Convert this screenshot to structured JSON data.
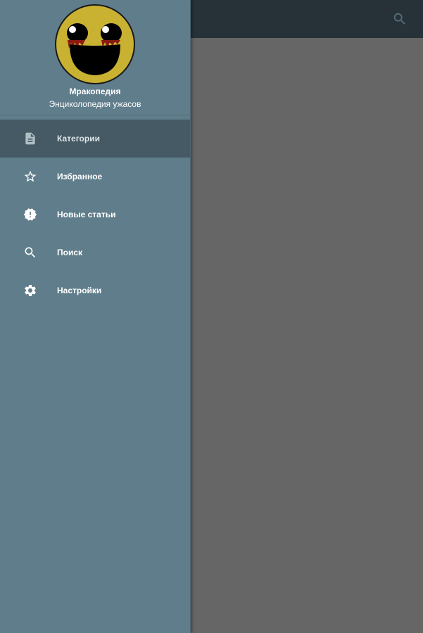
{
  "colors": {
    "appbar": "#263238",
    "drawer": "#607d8b",
    "drawer_active": "#455a64",
    "content_scrim": "#666666",
    "avatar_face": "#c9b132"
  },
  "header": {
    "app_name": "Мракопедия",
    "app_subtitle": "Энциколопедия ужасов",
    "avatar_icon": "creepy-smiley-logo"
  },
  "appbar": {
    "search_icon": "search-icon"
  },
  "menu": {
    "items": [
      {
        "label": "Категории",
        "icon": "document-icon",
        "active": true
      },
      {
        "label": "Избранное",
        "icon": "star-outline-icon",
        "active": false
      },
      {
        "label": "Новые статьи",
        "icon": "new-badge-icon",
        "active": false
      },
      {
        "label": "Поиск",
        "icon": "search-icon",
        "active": false
      },
      {
        "label": "Настройки",
        "icon": "gear-icon",
        "active": false
      }
    ]
  }
}
